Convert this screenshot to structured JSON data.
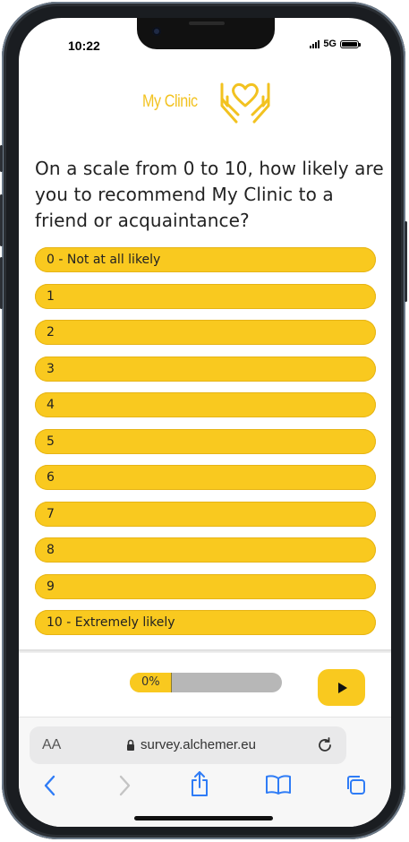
{
  "status_bar": {
    "time": "10:22",
    "network": "5G"
  },
  "brand": {
    "name": "My Clinic",
    "color": "#f2c220",
    "icon": "caring-hands-heart-icon"
  },
  "survey": {
    "question": "On a scale from 0 to 10, how likely are you to recommend My Clinic to a friend or acquaintance?",
    "options": [
      "0 - Not at all likely",
      "1",
      "2",
      "3",
      "4",
      "5",
      "6",
      "7",
      "8",
      "9",
      "10 - Extremely likely"
    ],
    "accent": "#f9c91f"
  },
  "footer": {
    "progress_label": "0%",
    "progress": 0,
    "next_icon": "play-arrow-icon"
  },
  "browser": {
    "text_size_label": "AA",
    "url": "survey.alchemer.eu"
  }
}
